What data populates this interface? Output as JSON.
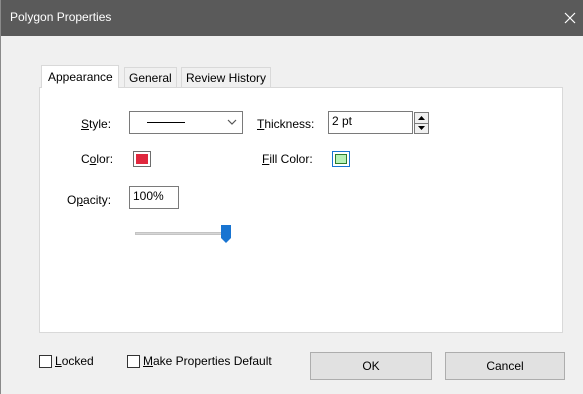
{
  "window": {
    "title": "Polygon Properties"
  },
  "tabs": [
    {
      "label": "Appearance",
      "active": true
    },
    {
      "label": "General",
      "active": false
    },
    {
      "label": "Review History",
      "active": false
    }
  ],
  "appearance": {
    "style": {
      "label_ul": "S",
      "label_rest": "tyle:",
      "value": "solid-line"
    },
    "thickness": {
      "label_ul": "T",
      "label_rest": "hickness:",
      "value": "2 pt"
    },
    "color": {
      "label_pre": "C",
      "label_ul": "o",
      "label_rest": "lor:",
      "value": "#e0283e"
    },
    "fill_color": {
      "label_ul": "F",
      "label_rest": "ill Color:",
      "value": "#b8f2b8"
    },
    "opacity": {
      "label_pre": "O",
      "label_ul": "p",
      "label_rest": "acity:",
      "value": "100%",
      "slider_fraction": 1.0
    }
  },
  "footer": {
    "locked": {
      "label_ul": "L",
      "label_rest": "ocked",
      "checked": false
    },
    "make_default": {
      "label_ul": "M",
      "label_rest": "ake Properties Default",
      "checked": false
    },
    "ok_label": "OK",
    "cancel_label": "Cancel"
  },
  "colors": {
    "titlebar": "#5a5a5a",
    "accent": "#1874d1"
  }
}
